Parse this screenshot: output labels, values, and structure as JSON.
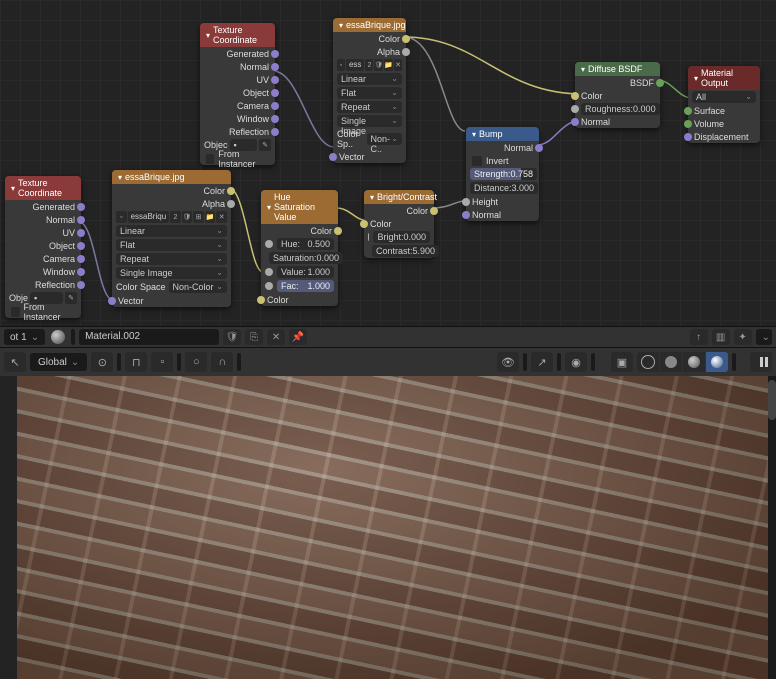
{
  "nodes": {
    "texcoord1": {
      "title": "Texture Coordinate",
      "outputs": [
        "Generated",
        "Normal",
        "UV",
        "Object",
        "Camera",
        "Window",
        "Reflection"
      ],
      "object_label": "Objec",
      "from_instancer": "From Instancer"
    },
    "texcoord2": {
      "title": "Texture Coordinate",
      "outputs": [
        "Generated",
        "Normal",
        "UV",
        "Object",
        "Camera",
        "Window",
        "Reflection"
      ],
      "object_label": "Obje",
      "from_instancer": "From Instancer"
    },
    "img1": {
      "title": "essaBrique.jpg",
      "out_color": "Color",
      "out_alpha": "Alpha",
      "file_short": "ess",
      "users": "2",
      "interp": "Linear",
      "proj": "Flat",
      "ext": "Repeat",
      "source": "Single Image",
      "cspace_lbl": "Color Sp..",
      "cspace_val": "Non-C..",
      "in_vector": "Vector"
    },
    "img2": {
      "title": "essaBrique.jpg",
      "out_color": "Color",
      "out_alpha": "Alpha",
      "file_short": "essaBriqu",
      "users": "2",
      "interp": "Linear",
      "proj": "Flat",
      "ext": "Repeat",
      "source": "Single Image",
      "cspace_lbl": "Color Space",
      "cspace_val": "Non-Color",
      "in_vector": "Vector"
    },
    "hsv": {
      "title": "Hue Saturation Value",
      "out_color": "Color",
      "hue_lbl": "Hue:",
      "hue_val": "0.500",
      "sat_lbl": "Saturation:",
      "sat_val": "0.000",
      "val_lbl": "Value:",
      "val_val": "1.000",
      "fac_lbl": "Fac:",
      "fac_val": "1.000",
      "in_color": "Color"
    },
    "bc": {
      "title": "Bright/Contrast",
      "out_color": "Color",
      "in_color": "Color",
      "bright_lbl": "Bright:",
      "bright_val": "0.000",
      "contrast_lbl": "Contrast:",
      "contrast_val": "5.900"
    },
    "bump": {
      "title": "Bump",
      "out_normal": "Normal",
      "invert": "Invert",
      "strength_lbl": "Strength:",
      "strength_val": "0.758",
      "distance_lbl": "Distance:",
      "distance_val": "3.000",
      "in_height": "Height",
      "in_normal": "Normal"
    },
    "diffuse": {
      "title": "Diffuse BSDF",
      "out_bsdf": "BSDF",
      "in_color": "Color",
      "rough_lbl": "Roughness:",
      "rough_val": "0.000",
      "in_normal": "Normal"
    },
    "output": {
      "title": "Material Output",
      "target": "All",
      "in_surface": "Surface",
      "in_volume": "Volume",
      "in_disp": "Displacement"
    }
  },
  "material_bar": {
    "slot": "ot 1",
    "material_name": "Material.002"
  },
  "viewport_bar": {
    "orientation": "Global"
  }
}
